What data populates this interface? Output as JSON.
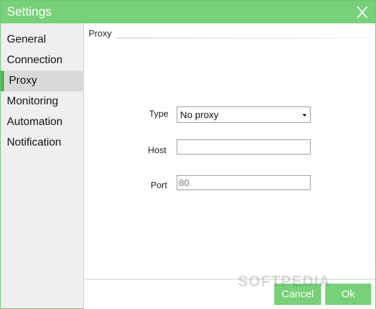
{
  "window": {
    "title": "Settings",
    "close_icon": "close-icon"
  },
  "sidebar": {
    "items": [
      {
        "label": "General",
        "active": false
      },
      {
        "label": "Connection",
        "active": false
      },
      {
        "label": "Proxy",
        "active": true
      },
      {
        "label": "Monitoring",
        "active": false
      },
      {
        "label": "Automation",
        "active": false
      },
      {
        "label": "Notification",
        "active": false
      }
    ]
  },
  "proxy": {
    "section_title": "Proxy",
    "type_label": "Type",
    "type_value": "No proxy",
    "host_label": "Host",
    "host_value": "",
    "port_label": "Port",
    "port_value": "80"
  },
  "footer": {
    "cancel_label": "Cancel",
    "ok_label": "Ok"
  },
  "watermark": "SOFTPEDIA",
  "colors": {
    "accent": "#76d178",
    "active_indicator": "#4cb84f",
    "sidebar_bg": "#efefef",
    "sidebar_active_bg": "#d9d9d9"
  }
}
